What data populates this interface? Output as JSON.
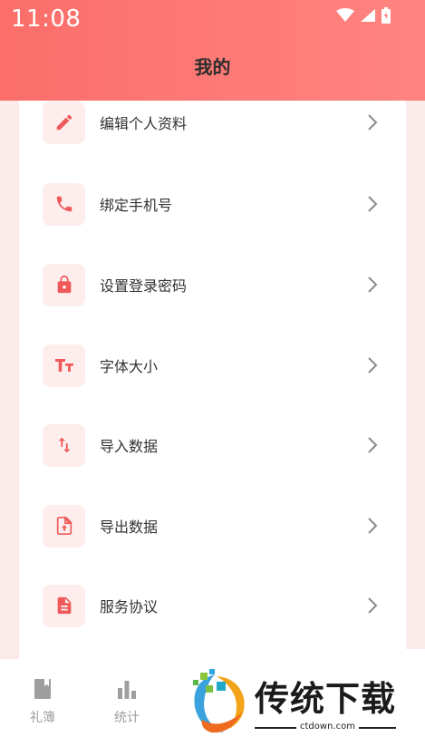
{
  "status_bar": {
    "time": "11:08"
  },
  "header": {
    "title": "我的"
  },
  "menu": {
    "items": [
      {
        "label": "编辑个人资料",
        "icon": "pencil-icon"
      },
      {
        "label": "绑定手机号",
        "icon": "phone-icon"
      },
      {
        "label": "设置登录密码",
        "icon": "lock-icon"
      },
      {
        "label": "字体大小",
        "icon": "font-size-icon"
      },
      {
        "label": "导入数据",
        "icon": "import-arrows-icon"
      },
      {
        "label": "导出数据",
        "icon": "export-file-icon"
      },
      {
        "label": "服务协议",
        "icon": "document-icon"
      }
    ]
  },
  "bottom_nav": {
    "tabs": [
      {
        "label": "礼簿",
        "icon": "book-icon"
      },
      {
        "label": "统计",
        "icon": "bar-chart-icon"
      }
    ]
  },
  "watermark": {
    "title": "传统下载",
    "url": "ctdown.com"
  },
  "colors": {
    "accent": "#fb6e6a",
    "icon_bg": "#fdeeed",
    "icon_fg": "#f0595a"
  }
}
